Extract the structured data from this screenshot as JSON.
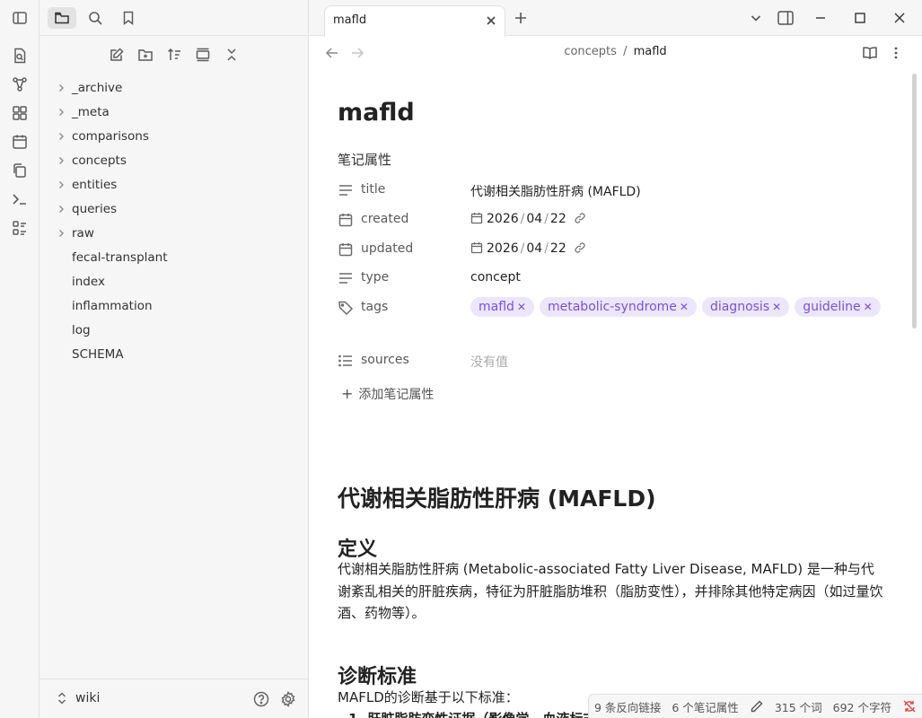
{
  "sidebar": {
    "tree": [
      {
        "label": "_archive",
        "folder": true
      },
      {
        "label": "_meta",
        "folder": true
      },
      {
        "label": "comparisons",
        "folder": true
      },
      {
        "label": "concepts",
        "folder": true
      },
      {
        "label": "entities",
        "folder": true
      },
      {
        "label": "queries",
        "folder": true
      },
      {
        "label": "raw",
        "folder": true
      },
      {
        "label": "fecal-transplant",
        "folder": false
      },
      {
        "label": "index",
        "folder": false
      },
      {
        "label": "inflammation",
        "folder": false
      },
      {
        "label": "log",
        "folder": false
      },
      {
        "label": "SCHEMA",
        "folder": false
      }
    ],
    "vault_name": "wiki"
  },
  "tab": {
    "title": "mafld"
  },
  "breadcrumb": {
    "folder": "concepts",
    "sep": "/",
    "file": "mafld"
  },
  "note": {
    "title": "mafld",
    "properties_heading": "笔记属性",
    "properties": {
      "title": {
        "name": "title",
        "value": "代谢相关脂肪性肝病 (MAFLD)"
      },
      "created": {
        "name": "created",
        "y": "2026",
        "m": "04",
        "d": "22"
      },
      "updated": {
        "name": "updated",
        "y": "2026",
        "m": "04",
        "d": "22"
      },
      "type": {
        "name": "type",
        "value": "concept"
      },
      "tags": {
        "name": "tags",
        "values": [
          "mafld",
          "metabolic-syndrome",
          "diagnosis",
          "guideline"
        ]
      },
      "sources": {
        "name": "sources",
        "value": "没有值"
      }
    },
    "add_property": "添加笔记属性",
    "h1": "代谢相关脂肪性肝病 (MAFLD)",
    "h2_definition": "定义",
    "definition_text": "代谢相关脂肪性肝病 (Metabolic-associated Fatty Liver Disease, MAFLD) 是一种与代谢紊乱相关的肝脏疾病，特征为肝脏脂肪堆积（脂肪变性），并排除其他特定病因（如过量饮酒、药物等）。",
    "h2_criteria": "诊断标准",
    "criteria_intro": "MAFLD的诊断基于以下标准：",
    "criteria_item_1": "肝脏脂肪变性证据（影像学、血液标志",
    "criteria_item_1_num": "1."
  },
  "status": {
    "backlinks": "9 条反向链接",
    "props": "6 个笔记属性",
    "words": "315 个词",
    "chars": "692 个字符"
  },
  "colors": {
    "tag_bg": "#ece6fb",
    "tag_text": "#7852d8"
  }
}
